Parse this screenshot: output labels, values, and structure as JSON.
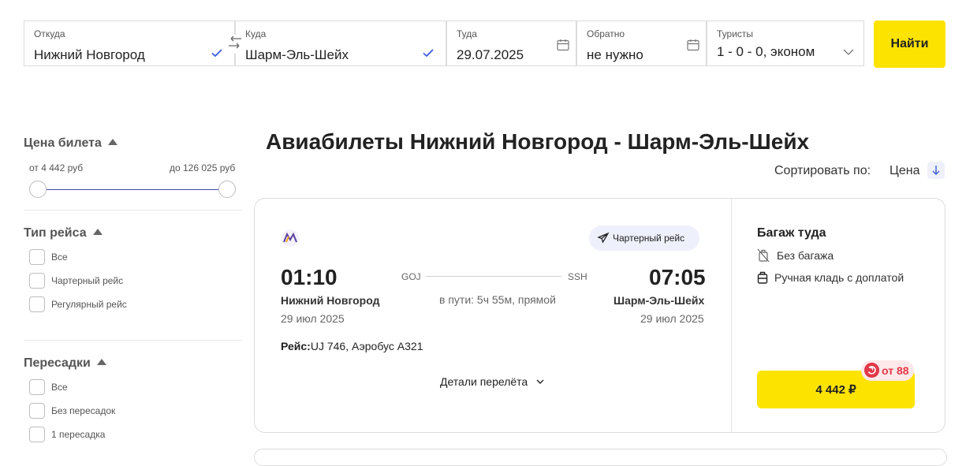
{
  "search": {
    "from_label": "Откуда",
    "from_value": "Нижний Новгород",
    "to_label": "Куда",
    "to_value": "Шарм-Эль-Шейх",
    "depart_label": "Туда",
    "depart_value": "29.07.2025",
    "return_label": "Обратно",
    "return_value": "не нужно",
    "tourists_label": "Туристы",
    "tourists_value": "1 - 0 - 0, эконом",
    "find_button": "Найти"
  },
  "sidebar": {
    "price": {
      "title": "Цена билета",
      "from": "от 4 442 руб",
      "to": "до 126 025 руб"
    },
    "flight_type": {
      "title": "Тип рейса",
      "options": [
        "Все",
        "Чартерный рейс",
        "Регулярный рейс"
      ]
    },
    "transfers": {
      "title": "Пересадки",
      "options": [
        "Все",
        "Без пересадок",
        "1 пересадка"
      ]
    }
  },
  "main": {
    "title": "Авиабилеты Нижний Новгород - Шарм-Эль-Шейх",
    "sort_label": "Сортировать по:",
    "sort_value": "Цена"
  },
  "ticket": {
    "charter_badge": "Чартерный рейс",
    "depart_time": "01:10",
    "depart_city": "Нижний Новгород",
    "depart_date": "29 июл 2025",
    "depart_iata": "GOJ",
    "arrive_time": "07:05",
    "arrive_city": "Шарм-Эль-Шейх",
    "arrive_date": "29 июл 2025",
    "arrive_iata": "SSH",
    "duration": "в пути: 5ч 55м, прямой",
    "flight_label": "Рейс:",
    "flight_value": "UJ 746, Аэробус А321",
    "details_link": "Детали перелёта",
    "baggage_title": "Багаж туда",
    "baggage_none": "Без багажа",
    "hand_luggage": "Ручная кладь с доплатой",
    "cashback": "от 88",
    "price": "4 442 ₽"
  },
  "colors": {
    "accent_yellow": "#fde300",
    "slider_blue": "#3a4ea8",
    "check_blue": "#3b5bdb",
    "cashback_red": "#e23848",
    "logo_purple": "#5b3fa0",
    "logo_orange": "#f5a623"
  },
  "icons": [
    "check-icon",
    "swap-icon",
    "calendar-icon",
    "chevron-down-icon",
    "sort-arrow-icon",
    "airline-logo",
    "plane-icon",
    "no-baggage-icon",
    "hand-luggage-icon",
    "cashback-icon"
  ]
}
